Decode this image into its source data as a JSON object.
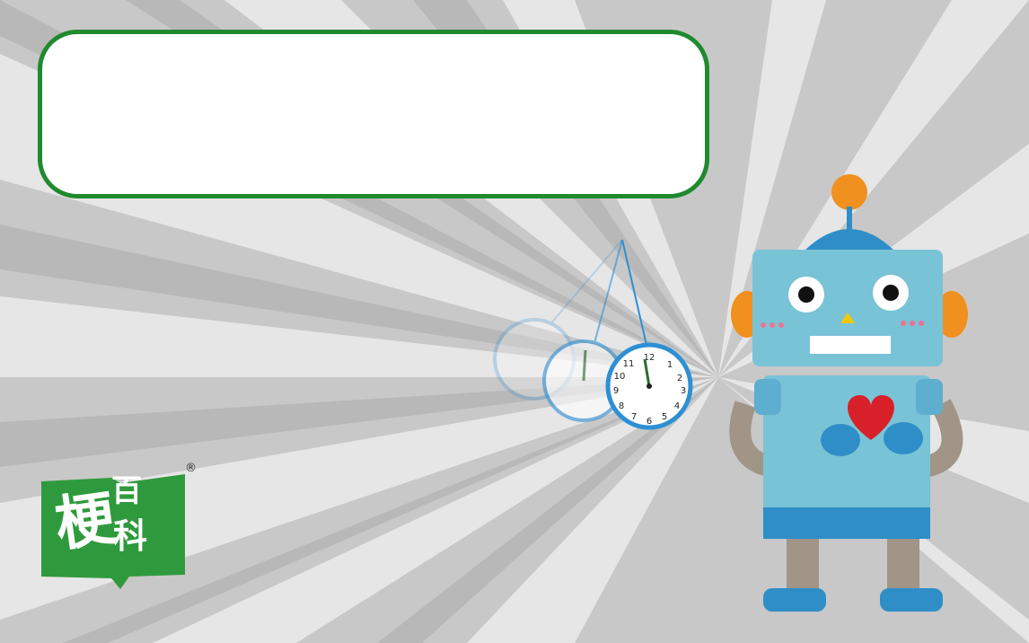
{
  "bubble": {
    "text": ""
  },
  "logo": {
    "line1": "梗",
    "line2": "百",
    "line3": "科",
    "registered": "®"
  },
  "colors": {
    "bubble_border": "#1f8a2e",
    "logo_green": "#2f9a3d",
    "robot_body": "#79c3d6",
    "robot_blue": "#2f8ec7",
    "robot_orange": "#f0901e",
    "heart": "#d8202a"
  },
  "icons": [
    "robot-illustration",
    "pendulum-clock-icon",
    "heart-icon",
    "book-logo-icon"
  ]
}
